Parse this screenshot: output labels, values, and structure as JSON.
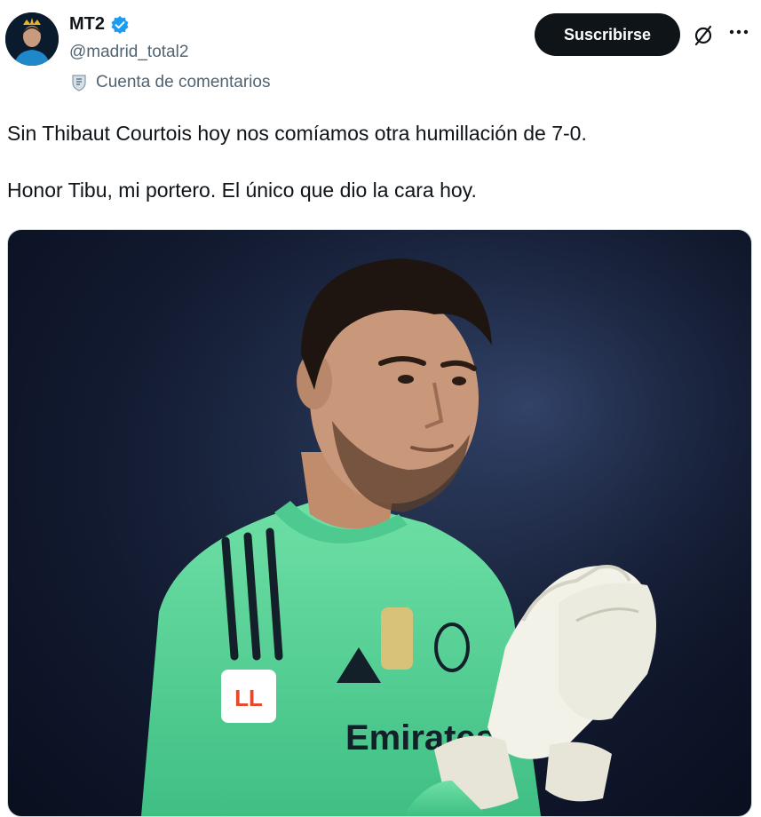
{
  "author": {
    "display_name": "MT2",
    "handle": "@madrid_total2",
    "account_label": "Cuenta de comentarios",
    "avatar_icon": "crowned-player-avatar",
    "verified_icon": "verified-badge-icon",
    "label_icon": "shield-icon"
  },
  "actions": {
    "subscribe_label": "Suscribirse",
    "grok_icon": "grok-icon",
    "more_icon": "more-options-icon"
  },
  "tweet": {
    "line1": "Sin Thibaut Courtois hoy nos comíamos otra humillación de 7-0.",
    "line2": "Honor Tibu, mi portero. El único que dio la cara hoy."
  },
  "media": {
    "kit_sponsor": "Emirates",
    "kit_badge": "LL"
  },
  "colors": {
    "verified_blue": "#1d9bf0",
    "text_primary": "#0f1419",
    "text_secondary": "#536471",
    "button_bg": "#0f1419",
    "kit_green": "#5fd39a"
  }
}
